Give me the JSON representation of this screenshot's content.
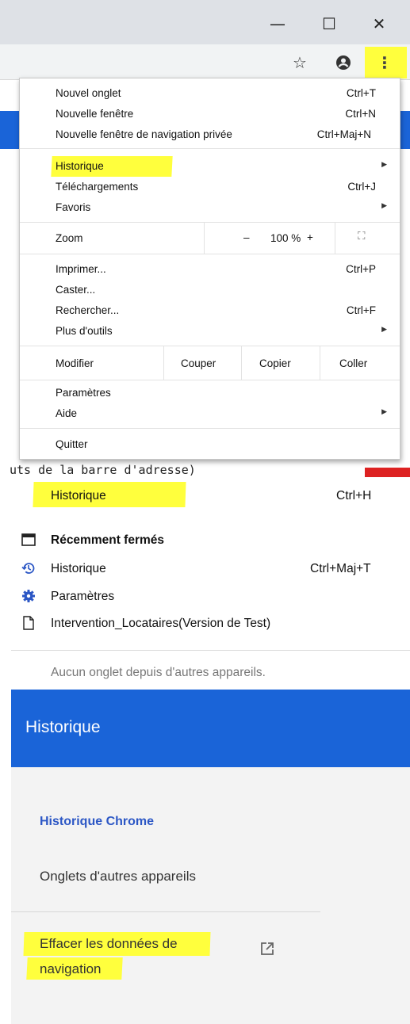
{
  "window": {
    "minimize_icon": "minimize-icon",
    "maximize_icon": "maximize-icon",
    "close_icon": "close-icon",
    "minimize_glyph": "—",
    "maximize_glyph": "☐",
    "close_glyph": "✕"
  },
  "toolbar": {
    "star_glyph": "☆",
    "account_glyph": "●",
    "kebab_glyph": "⋮"
  },
  "background_text": "uts de la barre d'adresse)",
  "chrome_menu": {
    "new_tab": {
      "label": "Nouvel onglet",
      "shortcut": "Ctrl+T"
    },
    "new_window": {
      "label": "Nouvelle fenêtre",
      "shortcut": "Ctrl+N"
    },
    "new_private": {
      "label": "Nouvelle fenêtre de navigation privée",
      "shortcut": "Ctrl+Maj+N"
    },
    "history": {
      "label": "Historique",
      "arrow": "▶"
    },
    "downloads": {
      "label": "Téléchargements",
      "shortcut": "Ctrl+J"
    },
    "bookmarks": {
      "label": "Favoris",
      "arrow": "▶"
    },
    "zoom": {
      "label": "Zoom",
      "minus": "–",
      "value": "100 %",
      "plus": "+",
      "fullscreen": "⛶"
    },
    "print": {
      "label": "Imprimer...",
      "shortcut": "Ctrl+P"
    },
    "cast": {
      "label": "Caster..."
    },
    "find": {
      "label": "Rechercher...",
      "shortcut": "Ctrl+F"
    },
    "more_tools": {
      "label": "Plus d'outils",
      "arrow": "▶"
    },
    "edit": {
      "label": "Modifier",
      "cut": "Couper",
      "copy": "Copier",
      "paste": "Coller"
    },
    "settings": {
      "label": "Paramètres"
    },
    "help": {
      "label": "Aide",
      "arrow": "▶"
    },
    "quit": {
      "label": "Quitter"
    }
  },
  "history_submenu": {
    "history": {
      "label": "Historique",
      "shortcut": "Ctrl+H"
    },
    "recently_closed": {
      "label": "Récemment fermés"
    },
    "history_restore": {
      "label": "Historique",
      "shortcut": "Ctrl+Maj+T"
    },
    "settings": {
      "label": "Paramètres"
    },
    "tab_item": {
      "label": "Intervention_Locataires(Version de Test)"
    },
    "no_tabs": {
      "label": "Aucun onglet depuis d'autres appareils."
    }
  },
  "history_page": {
    "title": "Historique",
    "chrome_history": "Historique Chrome",
    "other_devices": "Onglets d'autres appareils",
    "clear_line1": "Effacer les données de",
    "clear_line2": "navigation",
    "external_glyph": "⧉"
  },
  "colors": {
    "highlight": "#ffff3d",
    "chrome_blue": "#1a64d8",
    "link_blue": "#2c57c5"
  }
}
